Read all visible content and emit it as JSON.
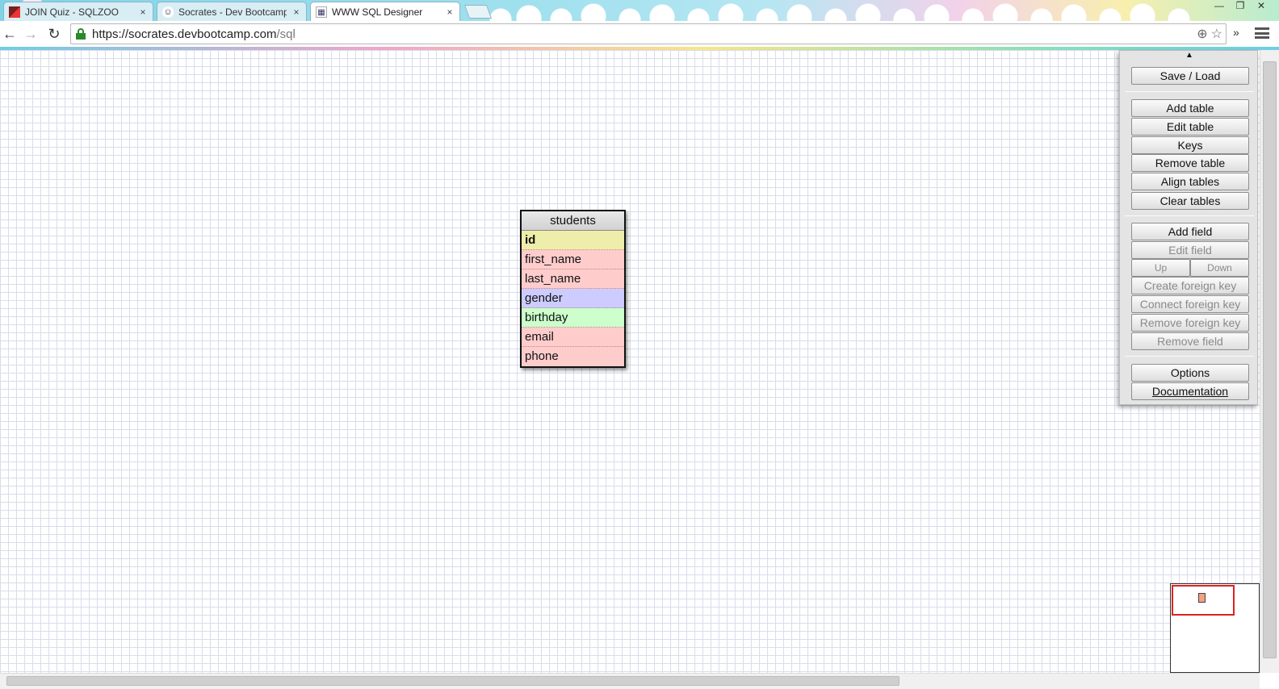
{
  "browser": {
    "tabs": [
      {
        "label": "JOIN Quiz - SQLZOO",
        "close": "×",
        "favicon": "sqlzoo-favicon"
      },
      {
        "label": "Socrates - Dev Bootcamp",
        "close": "×",
        "favicon": "socrates-favicon"
      },
      {
        "label": "WWW SQL Designer",
        "close": "×",
        "favicon": "wwwsqldesigner-favicon",
        "active": true
      }
    ],
    "window_buttons": {
      "minimize": "—",
      "restore": "❐",
      "close": "✕"
    },
    "nav": {
      "back": "←",
      "forward": "→",
      "reload": "↻"
    },
    "url": {
      "host": "https://socrates.devbootcamp.com",
      "path": "/sql"
    },
    "omnibox_icons": {
      "zoom": "⊕",
      "star": "☆"
    },
    "extensions_chevron": "»"
  },
  "table": {
    "name": "students",
    "fields": [
      {
        "name": "id",
        "color": "#eeeeaa",
        "primary": true
      },
      {
        "name": "first_name",
        "color": "#ffcccc"
      },
      {
        "name": "last_name",
        "color": "#ffcccc"
      },
      {
        "name": "gender",
        "color": "#ccccff"
      },
      {
        "name": "birthday",
        "color": "#ccffcc"
      },
      {
        "name": "email",
        "color": "#ffcccc"
      },
      {
        "name": "phone",
        "color": "#ffcccc"
      }
    ]
  },
  "panel": {
    "collapse": "▲",
    "save_load": "Save / Load",
    "add_table": "Add table",
    "edit_table": "Edit table",
    "keys": "Keys",
    "remove_table": "Remove table",
    "align_tables": "Align tables",
    "clear_tables": "Clear tables",
    "add_field": "Add field",
    "edit_field": "Edit field",
    "up": "Up",
    "down": "Down",
    "create_fk": "Create foreign key",
    "connect_fk": "Connect foreign key",
    "remove_fk": "Remove foreign key",
    "remove_field": "Remove field",
    "options": "Options",
    "documentation": "Documentation"
  }
}
